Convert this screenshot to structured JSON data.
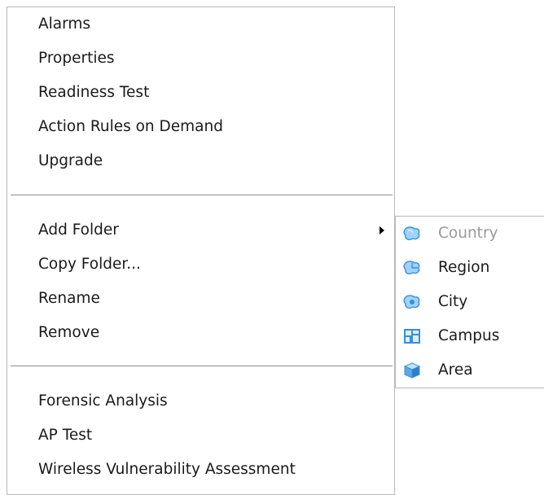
{
  "main_menu": {
    "group1": [
      "Alarms",
      "Properties",
      "Readiness Test",
      "Action Rules on Demand",
      "Upgrade"
    ],
    "group2": [
      "Add Folder",
      "Copy Folder...",
      "Rename",
      "Remove"
    ],
    "group3": [
      "Forensic Analysis",
      "AP Test",
      "Wireless Vulnerability Assessment"
    ]
  },
  "submenu": {
    "items": [
      {
        "label": "Country",
        "icon": "country-icon",
        "disabled": true
      },
      {
        "label": "Region",
        "icon": "region-icon",
        "disabled": false
      },
      {
        "label": "City",
        "icon": "city-icon",
        "disabled": false
      },
      {
        "label": "Campus",
        "icon": "campus-icon",
        "disabled": false
      },
      {
        "label": "Area",
        "icon": "area-icon",
        "disabled": false
      }
    ]
  },
  "colors": {
    "icon_blue": "#3a8fd8",
    "icon_light": "#9fd3ff",
    "disabled_text": "#9a9a9a"
  }
}
